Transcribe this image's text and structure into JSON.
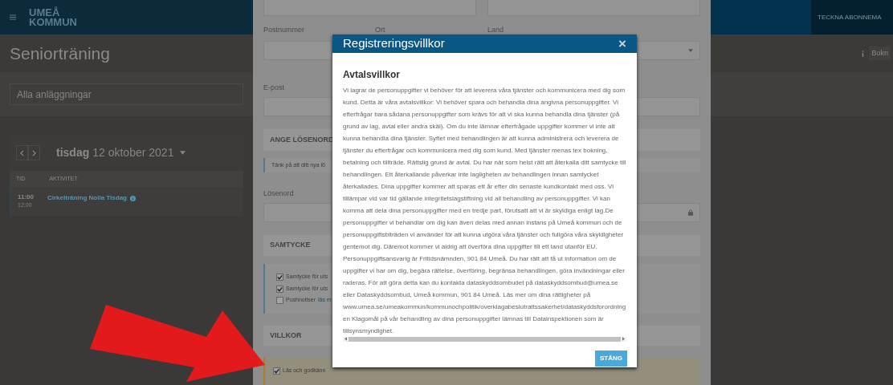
{
  "top_bar": {
    "logo_lines": [
      "UMEÅ",
      "KOMMUN"
    ],
    "subscribe_link": "TECKNA ABONNEMA"
  },
  "page": {
    "title": "Seniorträning",
    "facility_select": "Alla anläggningar",
    "info_button": "Bokn",
    "date_nav": {
      "weekday": "tisdag",
      "date": "12 oktober 2021"
    },
    "table": {
      "columns": [
        "TID",
        "AKTIVITET"
      ],
      "rows": [
        {
          "start": "11:00",
          "end": "12:00",
          "activity": "Cirkelträning Nolia Tisdag"
        }
      ]
    }
  },
  "form": {
    "labels": {
      "postal_code": "Postnummer",
      "city": "Ort",
      "country": "Land",
      "email": "E-post",
      "password": "Lösenord"
    },
    "password_section": "ANGE LÖSENORD",
    "password_hint": "Tänk på att ditt nya lö",
    "consent_section": "SAMTYCKE",
    "consents": [
      {
        "label": "Samtycke för uts",
        "checked": true
      },
      {
        "label": "Samtycke för uts",
        "checked": true
      },
      {
        "label": "Pushnotiser",
        "link": "läs m",
        "checked": false
      }
    ],
    "terms_section": "VILLKOR",
    "terms_checkbox": {
      "label": "Läs och godkänn",
      "checked": true
    }
  },
  "modal": {
    "title": "Registreringsvillkor",
    "close": "×",
    "heading": "Avtalsvillkor",
    "body": "Vi lagrar de personuppgifter vi behöver för att leverera våra tjänster och kommunicera med dig som kund. Detta är våra avtalsvillkor: Vi behöver spara och behandla dina angivna personuppgifter. Vi efterfrågar bara sådana personuppgifter som krävs för att vi ska kunna behandla dina tjänster (på grund av lag, avtal eller andra skäl). Om du inte lämnar efterfrågade uppgifter kommer vi inte att kunna behandla dina tjänster. Syftet med behandlingen är att kunna administrera och leverera de tjänster du efterfrågar och kommunicera med dig som kund. Med tjänster menas tex bokning, betalning och tillträde. Rättslig grund är avtal. Du har när som helst rätt att återkalla ditt samtycke till behandlingen. Ett återkallande påverkar inte lagligheten av behandlingen innan samtycket återkallades. Dina uppgifter kommer att sparas ett år efter din senaste kundkontakt med oss. Vi tillämpar vid var tid gällande integritetslagstiftning vid all behandling av personuppgifter. Vi kan komma att dela dina personuppgifter med en tredje part, förutsatt att vi är skyldiga enligt lag.De personuppgifter vi behandlar om dig kan även delas med annan instans på Umeå kommun och de personuppgiftsbiträden vi använder för att kunna utgöra våra tjänster och fullgöra våra skyldigheter gentemot dig. Däremot kommer vi aldrig att överföra dina uppgifter till ett land utanför EU. Personuppgiftsansvarig är Fritidsnämnden, 901 84 Umeå. Du har rätt att få ut information om de uppgifter vi har om dig, begära rättelse, överföring, begränsa behandlingen, göra invändningar eller raderas. För att göra detta kan du kontakta dataskyddsombudet på dataskyddsombud@umea.se eller Dataskyddsombud, Umeå kommun, 901 84 Umeå. Läs mer om dina rättigheter på www.umea.se/umeakommun/kommunochpolitik/overklagabeslutrattssakerhet/dataskyddsforordningen Klagomål på vår behandling av dina personuppgifter lämnas till Datainspektionen som är tillsynsmyndighet.",
    "button": "STÄNG"
  }
}
